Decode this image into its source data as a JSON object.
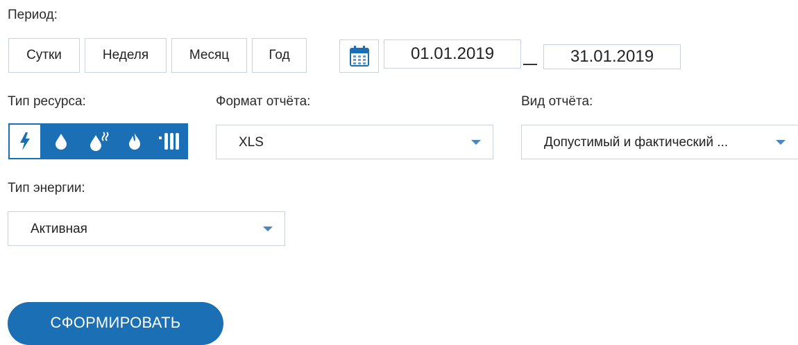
{
  "period": {
    "label": "Период:",
    "buttons": [
      "Сутки",
      "Неделя",
      "Месяц",
      "Год"
    ],
    "date_from": "01.01.2019",
    "date_to": "31.01.2019",
    "separator": "–"
  },
  "resource": {
    "label": "Тип ресурса:",
    "icons": [
      "electricity-icon",
      "water-drop-icon",
      "hot-water-icon",
      "gas-flame-icon",
      "radiator-heating-icon"
    ],
    "selected": "electricity-icon"
  },
  "report_format": {
    "label": "Формат отчёта:",
    "value": "XLS"
  },
  "report_type": {
    "label": "Вид отчёта:",
    "value": "Допустимый и фактический ..."
  },
  "energy_type": {
    "label": "Тип энергии:",
    "value": "Активная"
  },
  "submit_label": "СФОРМИРОВАТЬ",
  "colors": {
    "accent": "#1a6fb5",
    "border": "#c9d3dd",
    "arrow": "#4a86bd"
  }
}
